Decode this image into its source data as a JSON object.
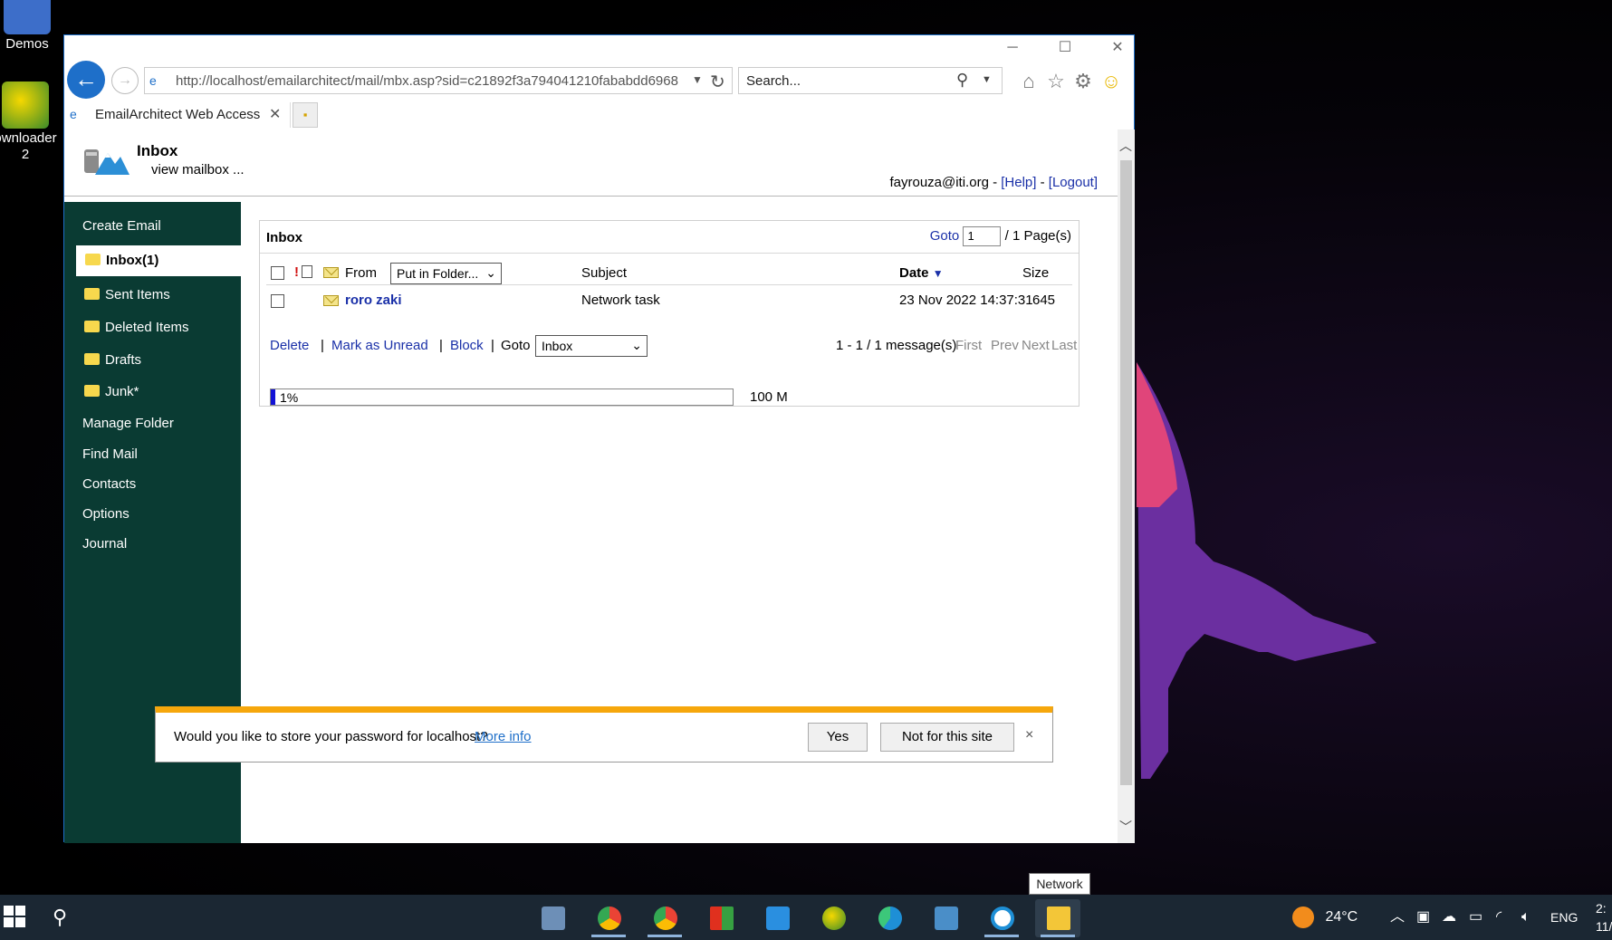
{
  "desktop": {
    "icons": [
      {
        "label": "Demos"
      },
      {
        "label": "ownloader"
      },
      {
        "label": "2"
      }
    ]
  },
  "browser": {
    "window_controls": {
      "minimize": "─",
      "maximize": "☐",
      "close": "✕"
    },
    "address": "http://localhost/emailarchitect/mail/mbx.asp?sid=c21892f3a794041210fababdd6968",
    "search_placeholder": "Search...",
    "tab_title": "EmailArchitect Web Access",
    "tab_close": "✕"
  },
  "page": {
    "title": "Inbox",
    "subtitle": "view mailbox ...",
    "user": "fayrouza@iti.org -",
    "help": "[Help]",
    "sep": "-",
    "logout": "[Logout]"
  },
  "sidebar": {
    "create_email": "Create Email",
    "inbox": "Inbox(1)",
    "folders": [
      "Sent Items",
      "Deleted Items",
      "Drafts",
      "Junk*"
    ],
    "manage_folder": "Manage Folder",
    "find_mail": "Find Mail",
    "contacts": "Contacts",
    "options": "Options",
    "journal": "Journal"
  },
  "inbox": {
    "title": "Inbox",
    "goto_label": "Goto",
    "goto_value": "1",
    "pages": "/ 1 Page(s)",
    "columns": {
      "from": "From",
      "folder_select": "Put in Folder...",
      "subject": "Subject",
      "date": "Date",
      "size": "Size"
    },
    "messages": [
      {
        "from": "roro zaki",
        "subject": "Network task",
        "date": "23 Nov 2022 14:37:31",
        "size": "645"
      }
    ],
    "actions": {
      "delete": "Delete",
      "mark_unread": "Mark as Unread",
      "block": "Block",
      "goto": "Goto",
      "goto_folder": "Inbox",
      "sep": "|"
    },
    "count": "1 - 1 / 1 message(s)",
    "pager": {
      "first": "First",
      "prev": "Prev",
      "next": "Next",
      "last": "Last"
    },
    "quota_percent_label": "1%",
    "quota_fraction": 0.01,
    "quota_total": "100 M"
  },
  "password_prompt": {
    "question": "Would you like to store your password for localhost?",
    "more_info": "More info",
    "yes": "Yes",
    "no": "Not for this site",
    "close": "×"
  },
  "taskbar": {
    "tooltip": "Network",
    "weather": "24°C",
    "lang": "ENG",
    "clock": "2:",
    "date": "11/"
  },
  "colors": {
    "accent": "#1e6fc9",
    "sidebar": "#0a3b33",
    "link": "#1a30a8",
    "prompt_bar": "#f6a70c",
    "quota_fill": "#1313d6"
  }
}
